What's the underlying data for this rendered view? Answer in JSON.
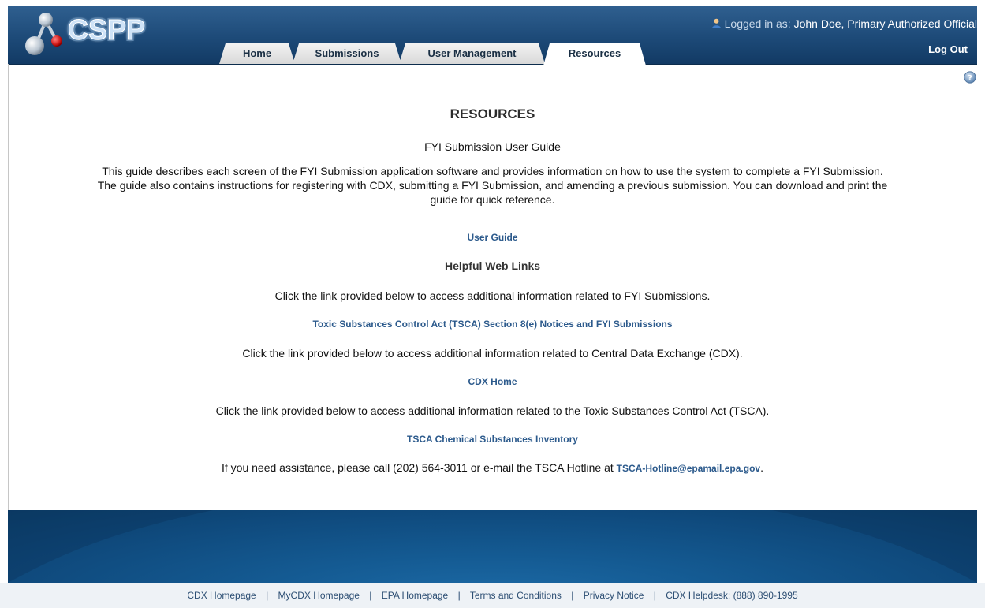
{
  "app": {
    "logo_text": "CSPP",
    "login_prefix": "Logged in as:",
    "login_user": "John Doe, Primary Authorized Official",
    "logout_label": "Log Out"
  },
  "tabs": [
    {
      "label": "Home"
    },
    {
      "label": "Submissions"
    },
    {
      "label": "User Management"
    },
    {
      "label": "Resources",
      "active": true
    }
  ],
  "main": {
    "title": "RESOURCES",
    "guide_heading": "FYI Submission User Guide",
    "guide_description_lines": [
      "This guide describes each screen of the FYI Submission application software and provides information on how to use the system to complete a FYI Submission.",
      "The guide also contains instructions for registering with CDX, submitting a FYI Submission, and amending a previous submission. You can download and print the",
      "guide for quick reference."
    ],
    "user_guide_link": "User Guide",
    "weblinks_heading": "Helpful Web Links",
    "fyi_text": "Click the link provided below to access additional information related to FYI Submissions.",
    "fyi_link": "Toxic Substances Control Act (TSCA) Section 8(e) Notices and FYI Submissions",
    "cdx_text": "Click the link provided below to access additional information related to Central Data Exchange (CDX).",
    "cdx_link": "CDX Home",
    "tsca_text": "Click the link provided below to access additional information related to the Toxic Substances Control Act (TSCA).",
    "tsca_link": "TSCA Chemical Substances Inventory",
    "assist_text": "If you need assistance, please call (202) 564-3011 or e-mail the TSCA Hotline at",
    "assist_email": "TSCA-Hotline@epamail.epa.gov",
    "assist_period": "."
  },
  "footer": {
    "links": [
      {
        "label": "CDX Homepage"
      },
      {
        "label": "MyCDX Homepage"
      },
      {
        "label": "EPA Homepage"
      },
      {
        "label": "Terms and Conditions"
      },
      {
        "label": "Privacy Notice"
      },
      {
        "label": "CDX Helpdesk: (888) 890-1995"
      }
    ],
    "separator": "|"
  },
  "colors": {
    "header_blue": "#1d4a78",
    "link_blue": "#2c5a8c",
    "footer_blue": "#0f4a7d"
  },
  "icons": {
    "logo": "molecule-icon",
    "user": "user-icon",
    "help": "help-icon"
  }
}
